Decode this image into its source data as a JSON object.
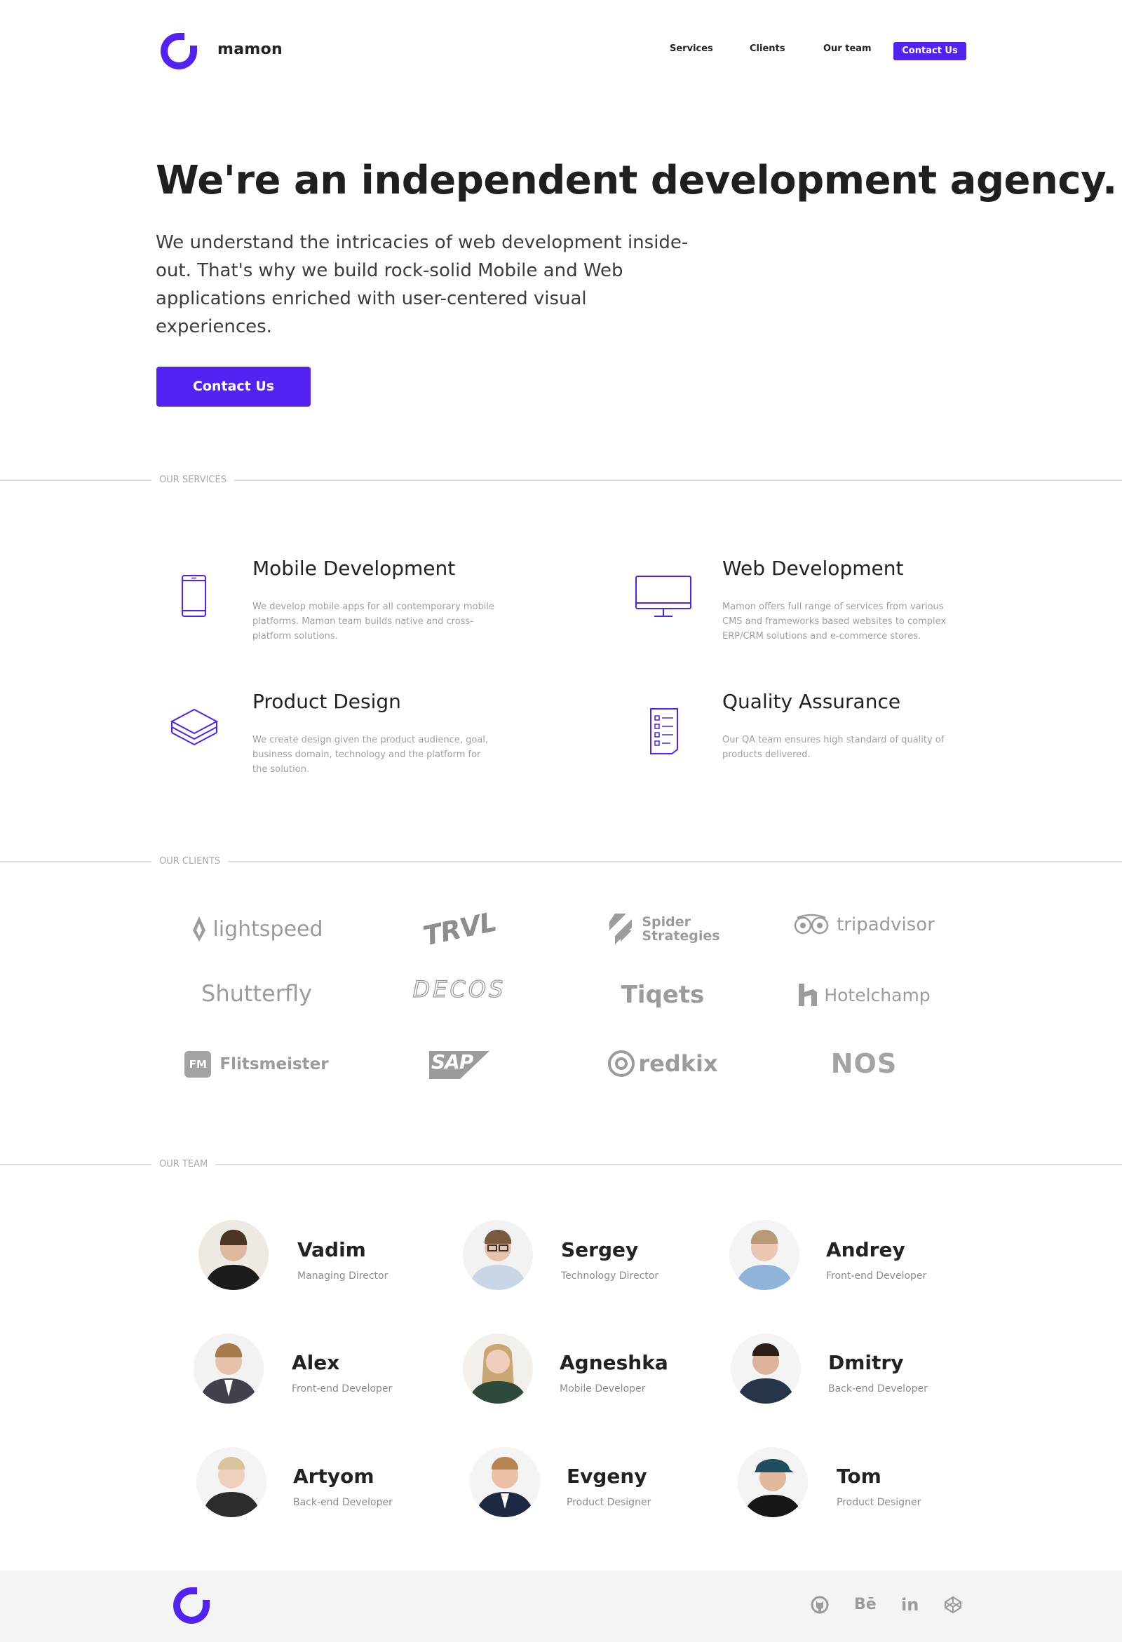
{
  "header": {
    "brand": "mamon",
    "nav": {
      "services": "Services",
      "clients": "Clients",
      "team": "Our team",
      "contact": "Contact Us"
    }
  },
  "hero": {
    "title": "We're an independent development agency.",
    "subtitle": "We understand the intricacies of web development inside-out. That's why we build rock-solid Mobile and Web applications enriched with user-centered visual experiences.",
    "cta": "Contact Us"
  },
  "sections": {
    "services": "OUR SERVICES",
    "clients": "OUR CLIENTS",
    "team": "OUR TEAM"
  },
  "services": [
    {
      "title": "Mobile Development",
      "desc": "We develop mobile apps for all contemporary mobile platforms. Mamon team builds native and cross-platform solutions.",
      "icon": "smartphone-icon"
    },
    {
      "title": "Web Development",
      "desc": "Mamon offers full range of services from various CMS and frameworks based websites to complex ERP/CRM solutions and e-commerce stores.",
      "icon": "monitor-icon"
    },
    {
      "title": "Product Design",
      "desc": "We create design given the product audience, goal, business domain, technology and the platform for the solution.",
      "icon": "layers-icon"
    },
    {
      "title": "Quality Assurance",
      "desc": "Our QA team ensures high standard of quality of products delivered.",
      "icon": "checklist-icon"
    }
  ],
  "clients": [
    "lightspeed",
    "TRVL",
    "Spider Strategies",
    "tripadvisor",
    "Shutterfly",
    "DECOS",
    "Tiqets",
    "Hotelchamp",
    "Flitsmeister",
    "SAP",
    "redkix",
    "NOS"
  ],
  "client_extra": {
    "spider_line1": "Spider",
    "spider_line2": "Strategies",
    "fm_badge": "FM"
  },
  "team": [
    {
      "name": "Vadim",
      "role": "Managing Director"
    },
    {
      "name": "Sergey",
      "role": "Technology Director"
    },
    {
      "name": "Andrey",
      "role": "Front-end Developer"
    },
    {
      "name": "Alex",
      "role": "Front-end Developer"
    },
    {
      "name": "Agneshka",
      "role": "Mobile Developer"
    },
    {
      "name": "Dmitry",
      "role": "Back-end Developer"
    },
    {
      "name": "Artyom",
      "role": "Back-end Developer"
    },
    {
      "name": "Evgeny",
      "role": "Product Designer"
    },
    {
      "name": "Tom",
      "role": "Product Designer"
    }
  ],
  "footer": {
    "social": [
      "github-icon",
      "behance-icon",
      "linkedin-icon",
      "codepen-icon"
    ],
    "behance_text": "Bē",
    "linkedin_text": "in"
  },
  "colors": {
    "accent": "#5122f2",
    "text": "#222222",
    "muted": "#a0a0a0",
    "logo_gray": "#9b9b9b"
  }
}
